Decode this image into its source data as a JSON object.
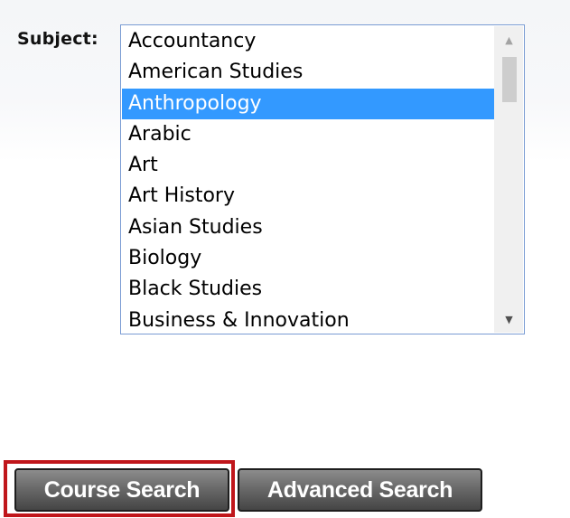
{
  "subject_filter": {
    "label": "Subject:",
    "options": [
      "Accountancy",
      "American Studies",
      "Anthropology",
      "Arabic",
      "Art",
      "Art History",
      "Asian Studies",
      "Biology",
      "Black Studies",
      "Business & Innovation"
    ],
    "selected": "Anthropology"
  },
  "actions": {
    "course_search_label": "Course Search",
    "advanced_search_label": "Advanced Search"
  },
  "colors": {
    "selection": "#3399ff",
    "highlight": "#c0161b",
    "button_dark": "#454545"
  },
  "icons": {
    "scroll_up": "triangle-up-icon",
    "scroll_down": "triangle-down-icon"
  }
}
